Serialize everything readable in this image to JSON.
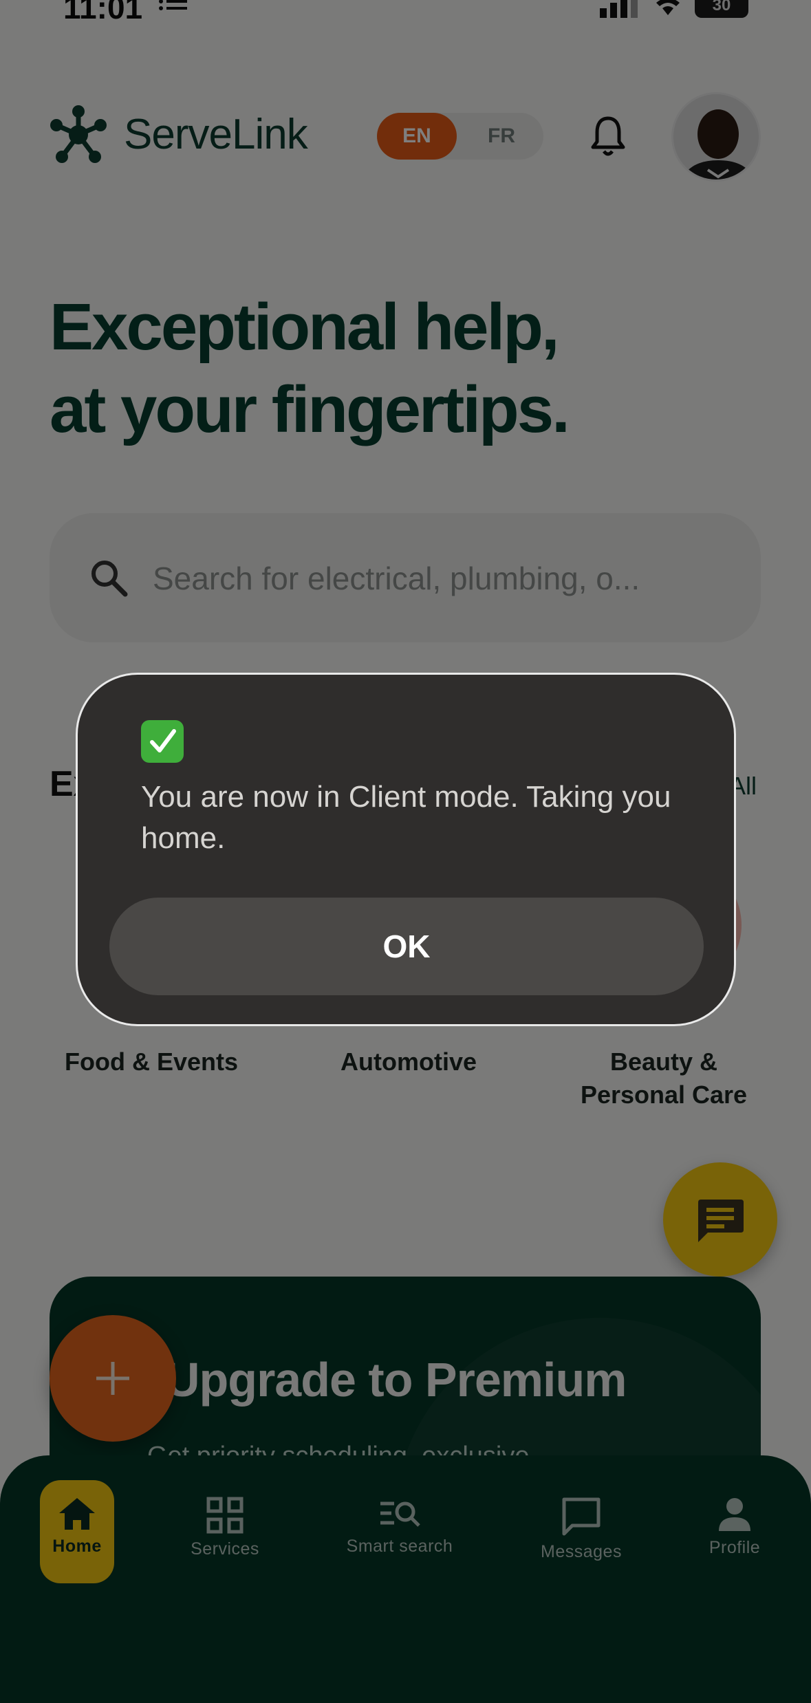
{
  "status_bar": {
    "time": "11:01",
    "battery": "30"
  },
  "header": {
    "brand": "ServeLink",
    "lang_en": "EN",
    "lang_fr": "FR"
  },
  "hero": {
    "line1": "Exceptional help,",
    "line2": "at your fingertips."
  },
  "search": {
    "placeholder": "Search for electrical, plumbing, o..."
  },
  "explore": {
    "title": "Ex",
    "see_all": "All",
    "categories": [
      {
        "line1": "Food & Events",
        "line2": "",
        "color": "#f0c030"
      },
      {
        "line1": "Automotive",
        "line2": "",
        "color": "#f4d27a"
      },
      {
        "line1": "Beauty &",
        "line2": "Personal Care",
        "color": "#f3b3a8"
      }
    ]
  },
  "premium": {
    "title": "Upgrade to Premium",
    "subtitle": "Get priority scheduling, exclusive"
  },
  "bottom_nav": {
    "items": [
      {
        "label": "Home",
        "icon": "home-icon"
      },
      {
        "label": "Services",
        "icon": "grid-icon"
      },
      {
        "label": "Smart search",
        "icon": "smart-search-icon"
      },
      {
        "label": "Messages",
        "icon": "message-icon"
      },
      {
        "label": "Profile",
        "icon": "person-icon"
      }
    ]
  },
  "dialog": {
    "icon": "check-mark-icon",
    "message": "You are now in Client mode. Taking you home.",
    "ok_label": "OK"
  },
  "colors": {
    "accent_orange": "#e45a16",
    "accent_yellow": "#f3c711",
    "brand_green": "#053626"
  }
}
